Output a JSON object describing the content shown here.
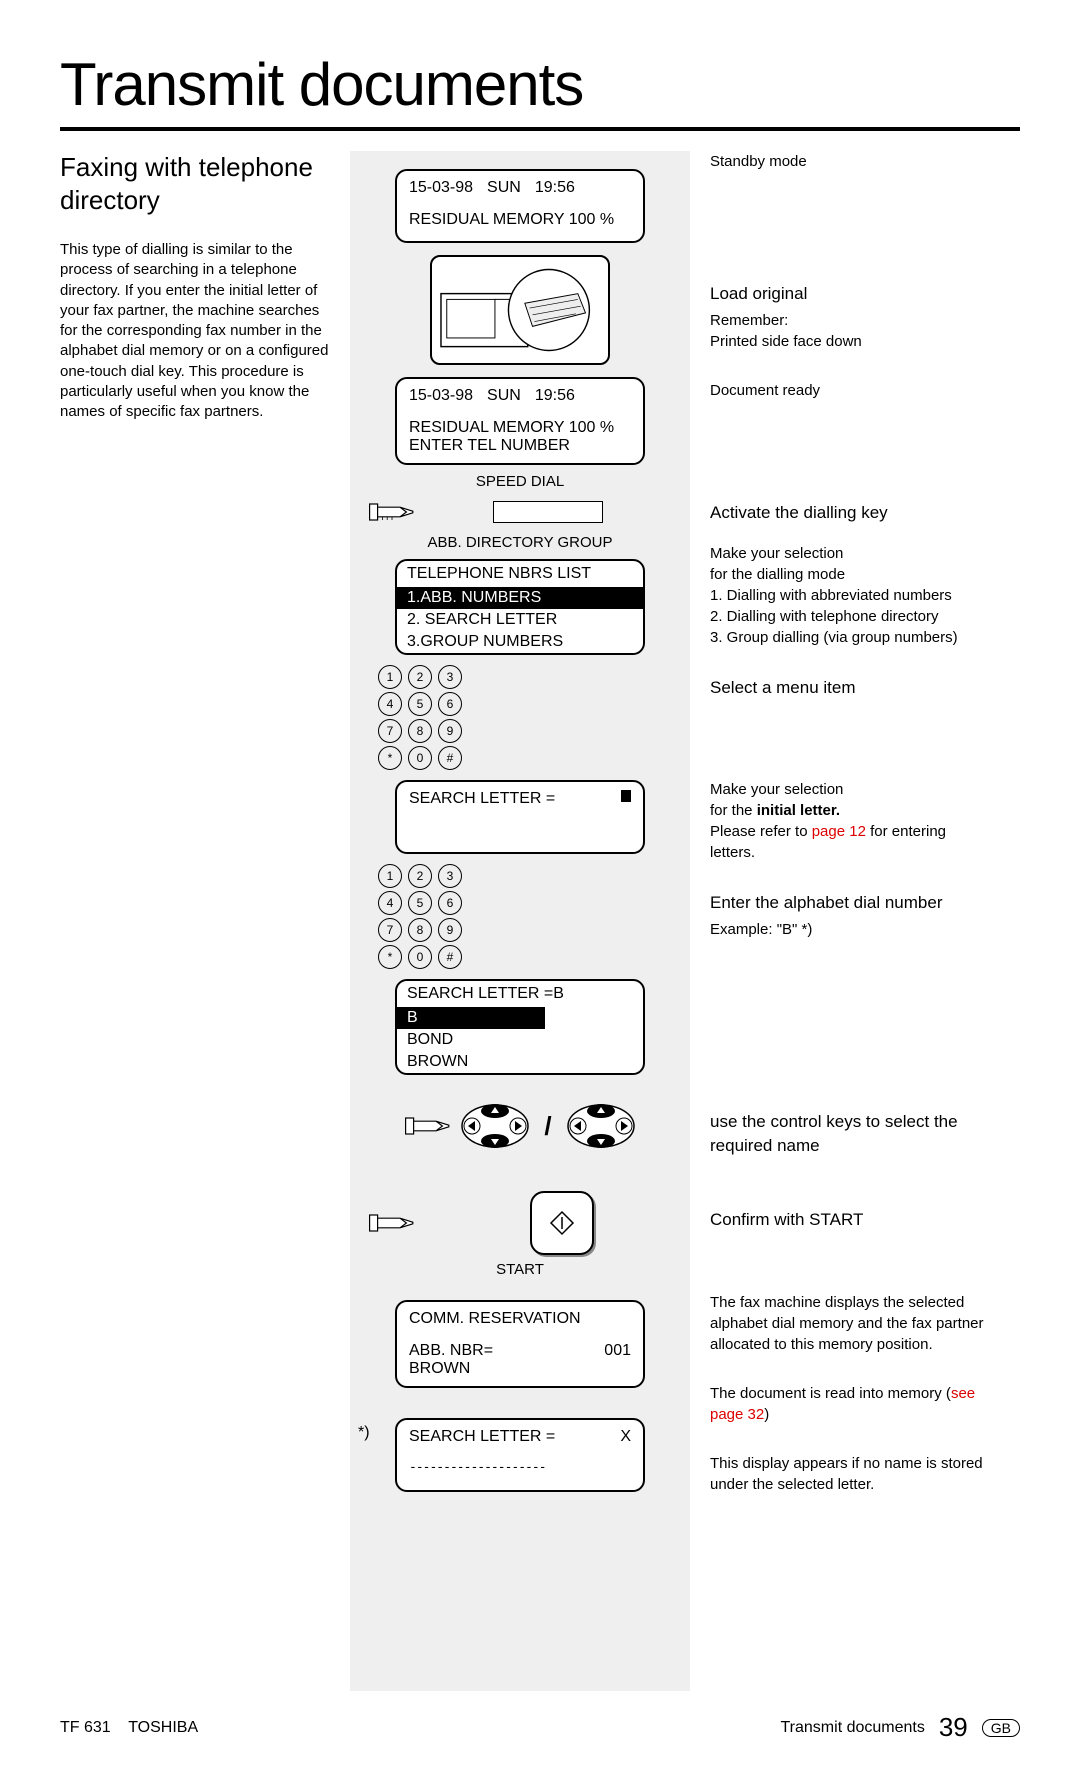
{
  "title": "Transmit documents",
  "subhead": "Faxing with telephone directory",
  "intro": "This type of dialling is similar to the process of searching in a telephone directory. If you enter the initial letter of your fax partner, the machine searches for the corresponding fax number in the alphabet dial memory or on a configured one-touch dial key. This procedure is particularly useful when you know the names of specific fax partners.",
  "lcd1": {
    "date": "15-03-98",
    "day": "SUN",
    "time": "19:56",
    "line2": "RESIDUAL MEMORY 100 %"
  },
  "lcd2": {
    "date": "15-03-98",
    "day": "SUN",
    "time": "19:56",
    "line2": "RESIDUAL MEMORY 100 %",
    "line3": "ENTER TEL NUMBER"
  },
  "keylabels": {
    "top": "SPEED DIAL",
    "bottom": "ABB. DIRECTORY GROUP"
  },
  "menu": {
    "header": "TELEPHONE NBRS LIST",
    "items": [
      "1.ABB. NUMBERS",
      "2. SEARCH LETTER",
      "3.GROUP NUMBERS"
    ],
    "selected": 0
  },
  "lcd3": {
    "line1": "SEARCH LETTER ="
  },
  "lcd4": {
    "line1": "SEARCH LETTER =B",
    "sel": "B",
    "r2": "BOND",
    "r3": "BROWN"
  },
  "startLabel": "START",
  "lcd5": {
    "line1": "COMM. RESERVATION",
    "line2l": "ABB. NBR=",
    "line2r": "001",
    "line3": "BROWN"
  },
  "lcd6": {
    "line1l": "SEARCH LETTER =",
    "line1r": "X",
    "dashes": "--------------------"
  },
  "footnoteMark": "*)",
  "right": {
    "r1": "Standby mode",
    "r2h": "Load original",
    "r2a": "Remember:",
    "r2b": "Printed side face down",
    "r3": "Document ready",
    "r4h": "Activate the dialling key",
    "r4a": "Make your selection",
    "r4b": "for the dialling mode",
    "r4c": "1. Dialling with abbreviated numbers",
    "r4d": "2. Dialling with telephone directory",
    "r4e": "3. Group dialling (via group numbers)",
    "r5h": "Select a menu item",
    "r6a": "Make your selection",
    "r6b_pre": "for the ",
    "r6b_bold": "initial letter.",
    "r6c_pre": "Please refer to ",
    "r6c_link": "page 12",
    "r6c_post": " for entering letters.",
    "r7h": "Enter the alphabet dial number",
    "r7a": "Example: \"B\" *)",
    "r8": "use the control keys to select the required name",
    "r9": "Confirm with START",
    "r10": "The fax machine displays the selected alphabet dial memory and the fax partner allocated to this memory position.",
    "r11_pre": "The document is read into memory (",
    "r11_link": "see page 32",
    "r11_post": ")",
    "r12": "This display appears if no name is stored under the selected letter."
  },
  "keypad": [
    [
      "1",
      "2",
      "3"
    ],
    [
      "4",
      "5",
      "6"
    ],
    [
      "7",
      "8",
      "9"
    ],
    [
      "*",
      "0",
      "#"
    ]
  ],
  "footer": {
    "left_model": "TF 631",
    "left_brand": "TOSHIBA",
    "right_section": "Transmit documents",
    "page": "39",
    "lang": "GB"
  }
}
